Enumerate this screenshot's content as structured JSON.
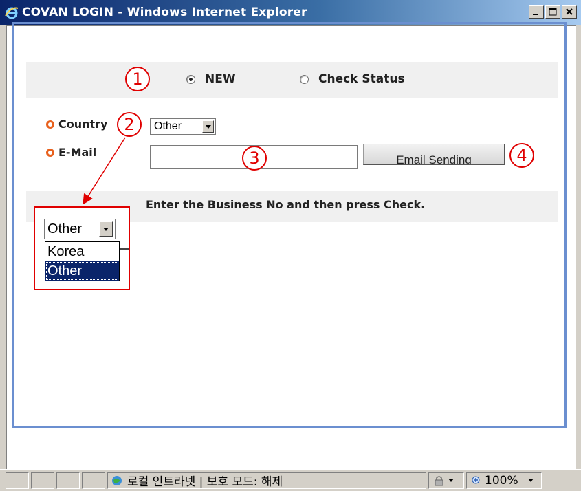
{
  "window": {
    "title": "COVAN LOGIN - Windows Internet Explorer"
  },
  "form": {
    "radio_new": "NEW",
    "radio_check_status": "Check Status",
    "radio_selected": "NEW",
    "country_label": "Country",
    "country_value": "Other",
    "email_label": "E-Mail",
    "email_value": "",
    "email_button": "Email Sending",
    "instruction": "Enter the Business No and then press Check."
  },
  "dropdown_zoom": {
    "selected_value": "Other",
    "options": [
      "Korea",
      "Other"
    ],
    "highlighted": "Other"
  },
  "annotations": {
    "callout_1": "1",
    "callout_2": "2",
    "callout_3": "3",
    "callout_4": "4"
  },
  "statusbar": {
    "zone_text": "로컬 인트라넷 | 보호 모드: 해제",
    "zoom": "100%"
  },
  "colors": {
    "accent_annotation": "#e00000",
    "frame_border": "#6b8fd0",
    "bullet": "#e8601c",
    "selection": "#0a246a"
  }
}
